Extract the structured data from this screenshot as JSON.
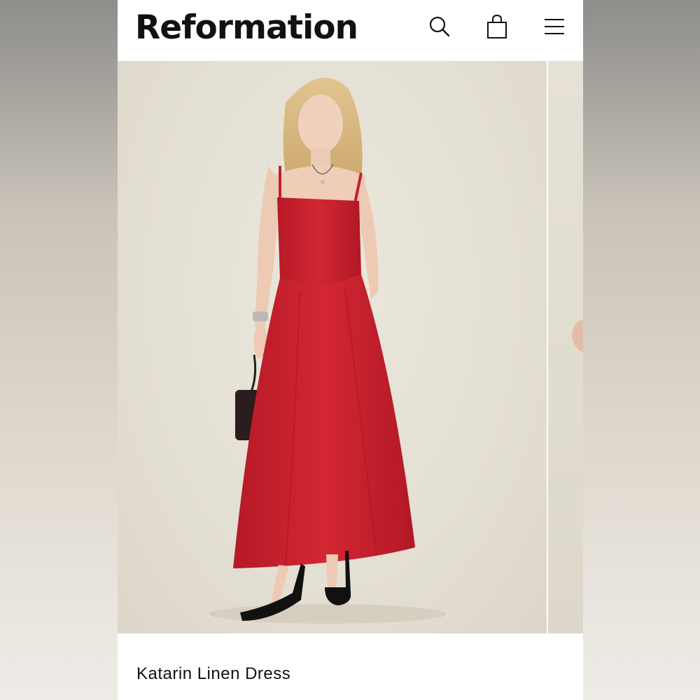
{
  "header": {
    "brand": "Reformation",
    "icons": [
      "search-icon",
      "shopping-bag-icon",
      "hamburger-menu-icon"
    ]
  },
  "product": {
    "name": "Katarin Linen Dress",
    "dress_color": "#c8202e",
    "background_color": "#e7e2d7"
  }
}
